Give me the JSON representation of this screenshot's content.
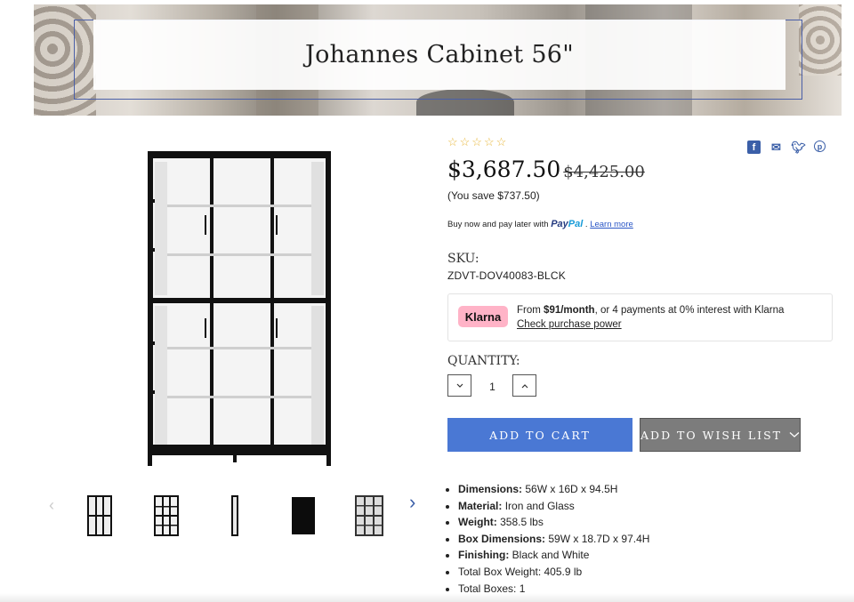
{
  "hero": {
    "title": "Johannes Cabinet 56\""
  },
  "product": {
    "stars": "☆☆☆☆☆",
    "price_current": "$3,687.50",
    "price_old": "$4,425.00",
    "you_save": "(You save $737.50)",
    "paypal": {
      "prefix": "Buy now and pay later with",
      "brand1": "Pay",
      "brand2": "Pal",
      "sep": ".",
      "learn_more": "Learn more"
    },
    "sku_label": "SKU:",
    "sku_value": "ZDVT-DOV40083-BLCK",
    "klarna": {
      "badge": "Klarna",
      "from": "From",
      "amount": "$91/month",
      "rest": ", or 4 payments at 0% interest with Klarna",
      "check": "Check purchase power"
    },
    "quantity_label": "QUANTITY:",
    "quantity_value": "1",
    "add_to_cart": "ADD TO CART",
    "add_to_wish": "ADD TO WISH LIST",
    "specs": [
      {
        "label": "Dimensions:",
        "value": "56W x 16D x 94.5H"
      },
      {
        "label": "Material:",
        "value": "Iron and Glass"
      },
      {
        "label": "Weight:",
        "value": "358.5 lbs"
      },
      {
        "label": "Box Dimensions:",
        "value": "59W x 18.7D x 97.4H"
      },
      {
        "label": "Finishing:",
        "value": "Black and White"
      },
      {
        "label": "",
        "value": "Total Box Weight: 405.9 lb"
      },
      {
        "label": "",
        "value": "Total Boxes: 1"
      }
    ]
  },
  "share": {
    "facebook": "facebook-icon",
    "email": "email-icon",
    "twitter": "twitter-icon",
    "pinterest": "pinterest-icon"
  },
  "colors": {
    "accent": "#4a78d4",
    "wish": "#7c7c7c",
    "stars": "#e8b73b",
    "klarna": "#ffb3c7",
    "link": "#3b5fa8"
  }
}
